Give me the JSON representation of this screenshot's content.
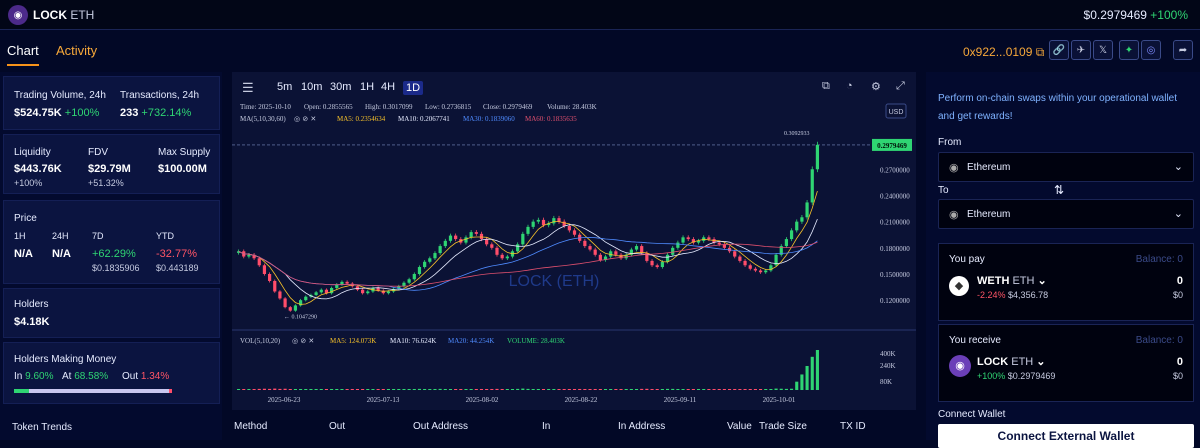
{
  "header": {
    "symbol": "LOCK",
    "pair": "ETH",
    "price": "$0.2979469",
    "change": "+100%"
  },
  "tabs": [
    "Chart",
    "Activity"
  ],
  "contract": {
    "address": "0x922...0109",
    "icons": [
      "link-icon",
      "telegram-icon",
      "x-icon",
      "share-icon-a",
      "globe-icon",
      "share-icon-b"
    ]
  },
  "stats": {
    "trading_volume_label": "Trading Volume, 24h",
    "trading_volume": "$524.75K",
    "trading_volume_change": "+100%",
    "transactions_label": "Transactions, 24h",
    "transactions": "233",
    "transactions_change": "+732.14%",
    "liquidity_label": "Liquidity",
    "liquidity": "$443.76K",
    "liquidity_change": "+100%",
    "fdv_label": "FDV",
    "fdv": "$29.79M",
    "fdv_change": "+51.32%",
    "max_supply_label": "Max Supply",
    "max_supply": "$100.00M",
    "price_label": "Price",
    "price_cols": [
      {
        "label": "1H",
        "value": "N/A",
        "sub": ""
      },
      {
        "label": "24H",
        "value": "N/A",
        "sub": ""
      },
      {
        "label": "7D",
        "value": "+62.29%",
        "sub": "$0.1835906"
      },
      {
        "label": "YTD",
        "value": "-32.77%",
        "sub": "$0.443189"
      }
    ],
    "holders_label": "Holders",
    "holders": "$4.18K",
    "making_money_label": "Holders Making Money",
    "in_label": "In",
    "in_value": "9.60%",
    "at_label": "At",
    "at_value": "68.58%",
    "out_label": "Out",
    "out_value": "1.34%",
    "token_trends_label": "Token Trends"
  },
  "chart_toolbar": {
    "timeframes": [
      "5m",
      "10m",
      "30m",
      "1H",
      "4H",
      "1D"
    ],
    "selected": "1D",
    "currency": "USD"
  },
  "chart_data": {
    "type": "candlestick",
    "info_line": {
      "time": "Time: 2025-10-10",
      "open": "Open: 0.2855565",
      "high": "High: 0.3017099",
      "low": "Low: 0.2736815",
      "close": "Close: 0.2979469",
      "volume": "Volume: 28.403K"
    },
    "ma_line": {
      "label": "MA(5,10,30,60)",
      "ma5": "MA5: 0.2354634",
      "ma10": "MA10: 0.2067741",
      "ma30": "MA30: 0.1839060",
      "ma60": "MA60: 0.1835635"
    },
    "vol_line": {
      "label": "VOL(5,10,20)",
      "ma5": "MA5: 124.073K",
      "ma10": "MA10: 76.624K",
      "ma20": "MA20: 44.254K",
      "volume": "VOLUME: 28.403K"
    },
    "watermark": "LOCK (ETH)",
    "y_ticks": [
      "0.2700000",
      "0.2400000",
      "0.2100000",
      "0.1800000",
      "0.1500000",
      "0.1200000"
    ],
    "vol_ticks": [
      "400K",
      "240K",
      "80K"
    ],
    "x_ticks": [
      "2025-06-23",
      "2025-07-13",
      "2025-08-02",
      "2025-08-22",
      "2025-09-11",
      "2025-10-01"
    ],
    "last_price_label": "0.2979469",
    "high_marker": "0.3092933",
    "low_marker": "0.1047290",
    "closes": [
      0.176,
      0.17,
      0.172,
      0.168,
      0.16,
      0.15,
      0.142,
      0.13,
      0.122,
      0.112,
      0.108,
      0.114,
      0.12,
      0.124,
      0.126,
      0.129,
      0.132,
      0.128,
      0.134,
      0.138,
      0.141,
      0.139,
      0.136,
      0.132,
      0.128,
      0.13,
      0.134,
      0.131,
      0.128,
      0.13,
      0.133,
      0.136,
      0.14,
      0.144,
      0.15,
      0.158,
      0.164,
      0.168,
      0.174,
      0.182,
      0.188,
      0.194,
      0.19,
      0.186,
      0.192,
      0.198,
      0.196,
      0.19,
      0.184,
      0.18,
      0.172,
      0.168,
      0.17,
      0.176,
      0.184,
      0.196,
      0.204,
      0.21,
      0.212,
      0.206,
      0.208,
      0.214,
      0.21,
      0.205,
      0.2,
      0.195,
      0.188,
      0.182,
      0.178,
      0.172,
      0.166,
      0.17,
      0.176,
      0.172,
      0.168,
      0.172,
      0.178,
      0.182,
      0.174,
      0.165,
      0.16,
      0.158,
      0.164,
      0.172,
      0.18,
      0.186,
      0.192,
      0.19,
      0.186,
      0.188,
      0.192,
      0.19,
      0.186,
      0.184,
      0.18,
      0.176,
      0.17,
      0.165,
      0.16,
      0.156,
      0.154,
      0.152,
      0.154,
      0.16,
      0.172,
      0.182,
      0.19,
      0.2,
      0.21,
      0.215,
      0.232,
      0.27,
      0.298
    ]
  },
  "table_headers": [
    "Method",
    "Out",
    "Out Address",
    "In",
    "In Address",
    "Value",
    "Trade Size",
    "TX ID"
  ],
  "swap": {
    "intro": "Perform on-chain swaps within your operational wallet and get rewards!",
    "from_label": "From",
    "from_chain": "Ethereum",
    "to_label": "To",
    "to_chain": "Ethereum",
    "pay_label": "You pay",
    "pay_balance": "Balance: 0",
    "pay_token": "WETH",
    "pay_token_chain": "ETH",
    "pay_change": "-2.24%",
    "pay_price": "$4,356.78",
    "pay_amount": "0",
    "pay_usd": "$0",
    "receive_label": "You receive",
    "receive_balance": "Balance: 0",
    "receive_token": "LOCK",
    "receive_token_chain": "ETH",
    "receive_change": "+100%",
    "receive_price": "$0.2979469",
    "receive_amount": "0",
    "receive_usd": "$0",
    "connect_label": "Connect Wallet",
    "connect_button": "Connect External Wallet"
  },
  "colors": {
    "up": "#2fd573",
    "down": "#ff4d6a",
    "accent": "#f7931a",
    "ma5": "#f7c22a",
    "ma10": "#e6ebff",
    "ma30": "#4f8bff",
    "ma60": "#e0506e"
  }
}
